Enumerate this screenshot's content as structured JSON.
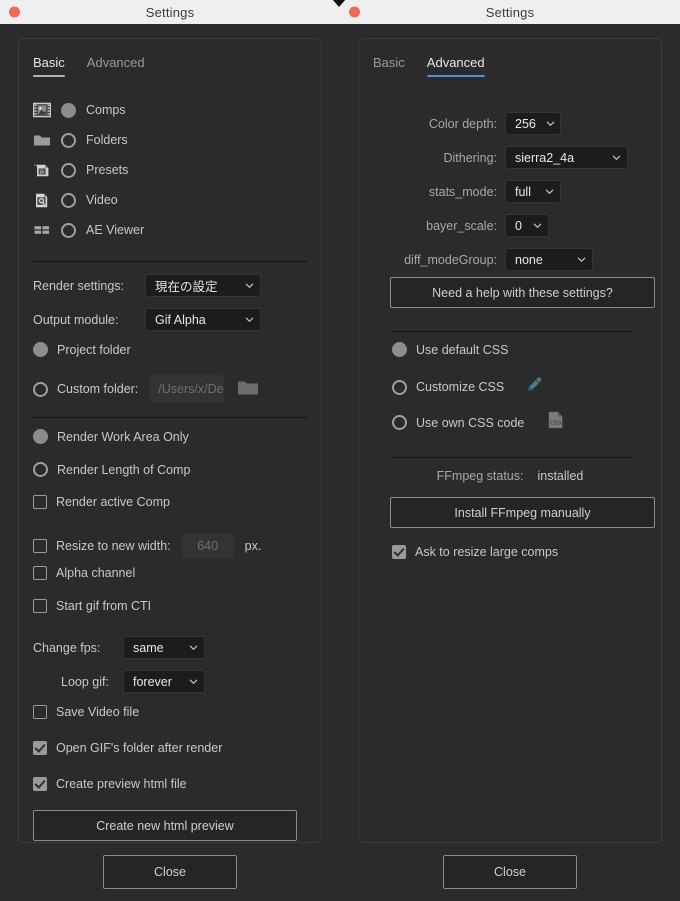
{
  "windows": {
    "left": {
      "title": "Settings",
      "tabs": [
        {
          "label": "Basic",
          "active": true
        },
        {
          "label": "Advanced",
          "active": false
        }
      ],
      "source_list": [
        {
          "icon": "comps-icon",
          "label": "Comps",
          "selected": true
        },
        {
          "icon": "folder-icon",
          "label": "Folders",
          "selected": false
        },
        {
          "icon": "presets-icon",
          "label": "Presets",
          "selected": false
        },
        {
          "icon": "video-icon",
          "label": "Video",
          "selected": false
        },
        {
          "icon": "ae-viewer-icon",
          "label": "AE Viewer",
          "selected": false
        }
      ],
      "render_settings": {
        "label": "Render settings:",
        "value": "現在の設定"
      },
      "output_module": {
        "label": "Output module:",
        "value": "Gif Alpha"
      },
      "destination": {
        "project_folder": {
          "label": "Project folder",
          "selected": true
        },
        "custom_folder": {
          "label": "Custom folder:",
          "selected": false,
          "placeholder": "/Users/x/Desk"
        },
        "browse_icon": "folder-browse-icon"
      },
      "range_options": [
        {
          "label": "Render Work Area Only",
          "type": "radio",
          "selected": true
        },
        {
          "label": "Render Length of Comp",
          "type": "radio",
          "selected": false
        },
        {
          "label": "Render active Comp",
          "type": "checkbox",
          "checked": false
        }
      ],
      "resize": {
        "label": "Resize to new width:",
        "checked": false,
        "placeholder": "640",
        "unit": "px."
      },
      "alpha_channel": {
        "label": "Alpha channel",
        "checked": false
      },
      "start_gif_cti": {
        "label": "Start gif from CTI",
        "checked": false
      },
      "change_fps": {
        "label": "Change fps:",
        "value": "same"
      },
      "loop_gif": {
        "label": "Loop gif:",
        "value": "forever"
      },
      "save_video_file": {
        "label": "Save Video file",
        "checked": false
      },
      "open_gif_folder": {
        "label": "Open GIF's folder after render",
        "checked": true
      },
      "create_preview": {
        "label": "Create preview html file",
        "checked": true
      },
      "create_preview_button": "Create new html preview",
      "close_button": "Close"
    },
    "right": {
      "title": "Settings",
      "tabs": [
        {
          "label": "Basic",
          "active": false
        },
        {
          "label": "Advanced",
          "active": true
        }
      ],
      "fields": [
        {
          "label": "Color depth:",
          "value": "256",
          "width": 56
        },
        {
          "label": "Dithering:",
          "value": "sierra2_4a",
          "width": 123
        },
        {
          "label": "stats_mode:",
          "value": "full",
          "width": 56
        },
        {
          "label": "bayer_scale:",
          "value": "0",
          "width": 44
        },
        {
          "label": "diff_modeGroup:",
          "value": "none",
          "width": 88
        }
      ],
      "help_button": "Need a help with these settings?",
      "css_options": [
        {
          "label": "Use default CSS",
          "selected": true,
          "icon": null
        },
        {
          "label": "Customize CSS",
          "selected": false,
          "icon": "eyedropper-icon"
        },
        {
          "label": "Use own CSS code",
          "selected": false,
          "icon": "css-file-icon"
        }
      ],
      "ffmpeg_status": {
        "label": "FFmpeg status:",
        "value": "installed"
      },
      "install_ffmpeg_button": "Install FFmpeg manually",
      "ask_resize": {
        "label": "Ask to resize large comps",
        "checked": true
      },
      "close_button": "Close"
    }
  },
  "colors": {
    "window_bg": "#2b2b2b",
    "titlebar_bg": "#efefef",
    "accent_blue": "#4a90d9",
    "traffic_red": "#ef6a5a",
    "text_primary": "#e6e6e6",
    "text_secondary": "#9a9a9a"
  }
}
